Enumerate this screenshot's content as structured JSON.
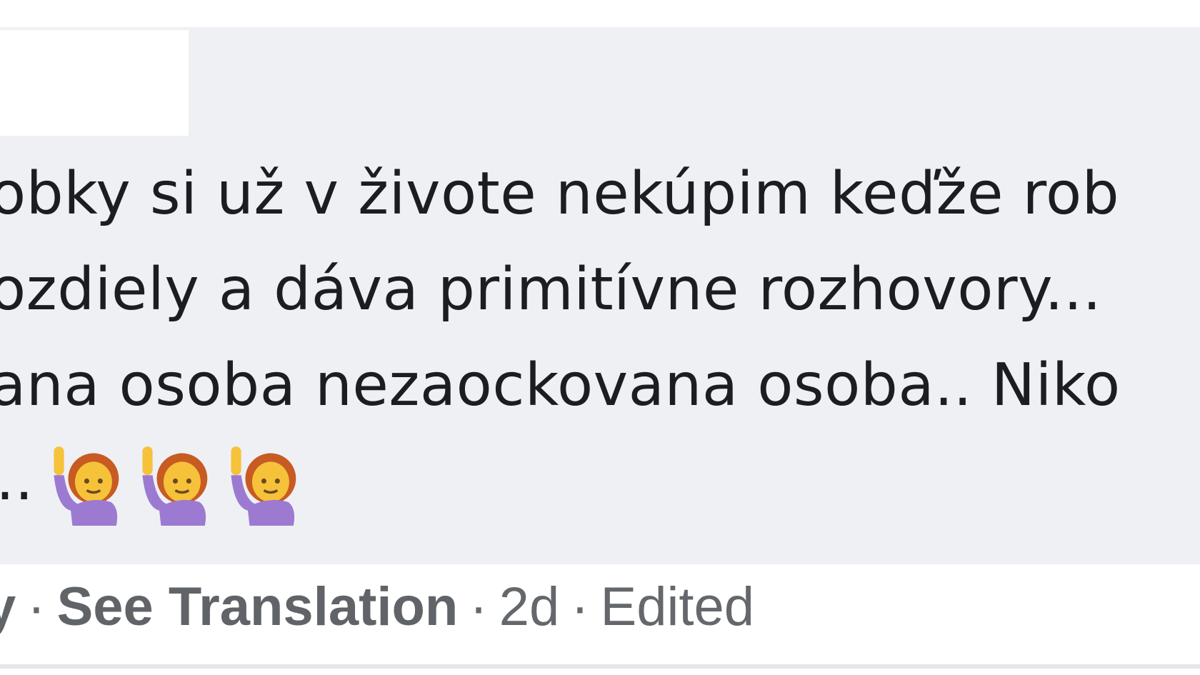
{
  "comment": {
    "author_redacted": "",
    "lines": [
      "obky si už v živote nekúpim keďže rob",
      "ozdiely a dáva primitívne rozhovory... ",
      "ana osoba nezaockovana osoba.. Niko",
      ".."
    ],
    "emojis": [
      "person-raising-hand-icon",
      "person-raising-hand-icon",
      "person-raising-hand-icon"
    ]
  },
  "actions": {
    "reply_fragment": "y",
    "see_translation": "See Translation",
    "time": "2d",
    "edited": "Edited"
  },
  "colors": {
    "bubble": "#eff0f4",
    "text": "#1c1d21",
    "meta": "#64676b",
    "emoji_skin": "#f6c23a",
    "emoji_hair": "#c75b22",
    "emoji_shirt": "#9c7ad1"
  }
}
